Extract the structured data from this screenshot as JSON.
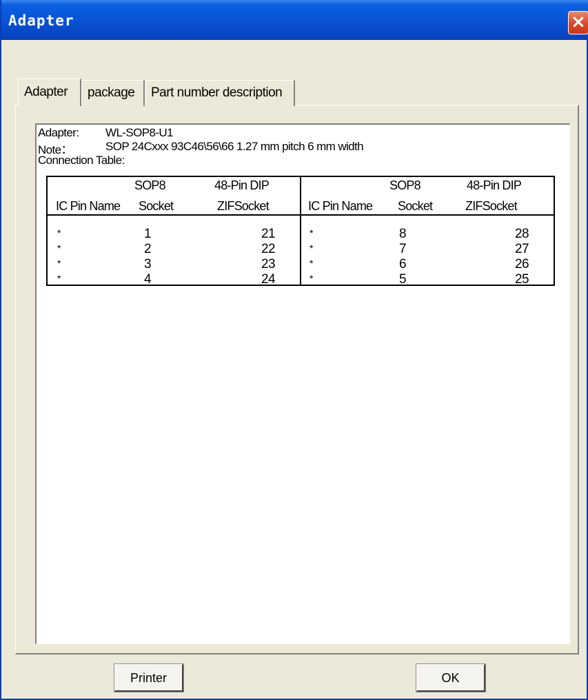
{
  "window": {
    "title": "Adapter",
    "close_glyph": "×"
  },
  "tabs": [
    {
      "label": "Adapter",
      "active": true
    },
    {
      "label": "package",
      "active": false
    },
    {
      "label": "Part number description",
      "active": false
    }
  ],
  "info": {
    "adapter_label": "Adapter:",
    "adapter_value": "WL-SOP8-U1",
    "note_label": "Note：",
    "note_value": "SOP  24Cxxx 93C46\\56\\66  1.27 mm pitch   6 mm width",
    "connection_label": "Connection Table:"
  },
  "table": {
    "left_header": {
      "row1_socket": "SOP8",
      "row1_dip": "48-Pin DIP",
      "col_name": "IC Pin Name",
      "col_socket": "Socket",
      "col_zif": "ZIFSocket"
    },
    "right_header": {
      "row1_socket": "SOP8",
      "row1_dip": "48-Pin DIP",
      "col_name": "IC Pin Name",
      "col_socket": "Socket",
      "col_zif": "ZIFSocket"
    },
    "left_rows": [
      {
        "name": "*",
        "socket": "1",
        "zif": "21"
      },
      {
        "name": "*",
        "socket": "2",
        "zif": "22"
      },
      {
        "name": "*",
        "socket": "3",
        "zif": "23"
      },
      {
        "name": "*",
        "socket": "4",
        "zif": "24"
      }
    ],
    "right_rows": [
      {
        "name": "*",
        "socket": "8",
        "zif": "28"
      },
      {
        "name": "*",
        "socket": "7",
        "zif": "27"
      },
      {
        "name": "*",
        "socket": "6",
        "zif": "26"
      },
      {
        "name": "*",
        "socket": "5",
        "zif": "25"
      }
    ]
  },
  "buttons": {
    "printer": "Printer",
    "ok": "OK"
  }
}
